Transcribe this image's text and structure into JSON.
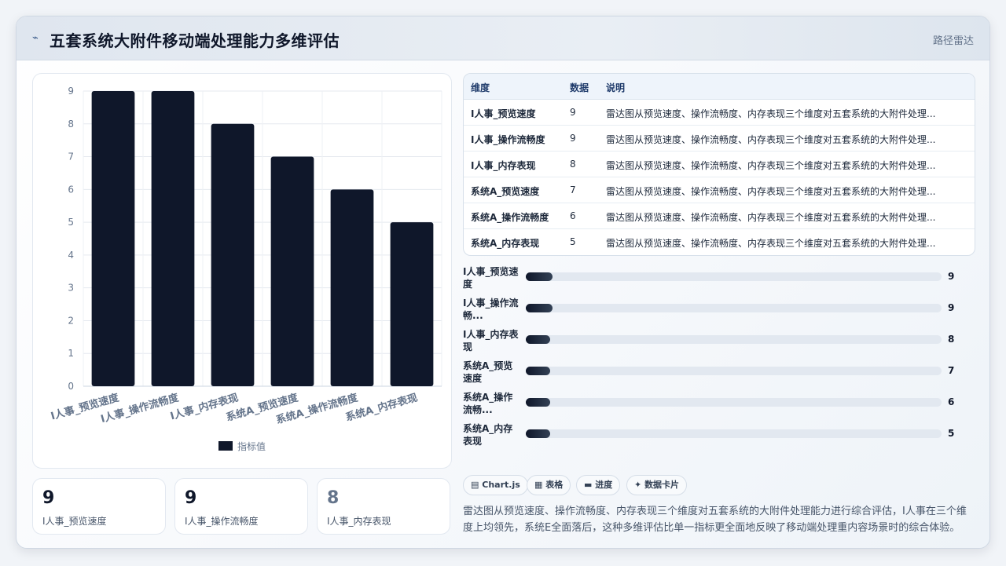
{
  "header": {
    "title": "五套系统大附件移动端处理能力多维评估",
    "icon": "trend-icon",
    "tag": "路径雷达"
  },
  "chart_data": {
    "type": "bar",
    "categories": [
      "I人事_预览速度",
      "I人事_操作流畅度",
      "I人事_内存表现",
      "系统A_预览速度",
      "系统A_操作流畅度",
      "系统A_内存表现"
    ],
    "series": [
      {
        "name": "指标值",
        "values": [
          9,
          9,
          8,
          7,
          6,
          5
        ]
      }
    ],
    "ylim": [
      0,
      9
    ],
    "yticks": [
      0,
      1,
      2,
      3,
      4,
      5,
      6,
      7,
      8,
      9
    ],
    "grid": true,
    "legend": "bottom",
    "bar_color": "#0f172a"
  },
  "table": {
    "columns": [
      "维度",
      "数据",
      "说明"
    ],
    "rows": [
      {
        "name": "I人事_预览速度",
        "value": "9",
        "note": "雷达图从预览速度、操作流畅度、内存表现三个维度对五套系统的大附件处理..."
      },
      {
        "name": "I人事_操作流畅度",
        "value": "9",
        "note": "雷达图从预览速度、操作流畅度、内存表现三个维度对五套系统的大附件处理..."
      },
      {
        "name": "I人事_内存表现",
        "value": "8",
        "note": "雷达图从预览速度、操作流畅度、内存表现三个维度对五套系统的大附件处理..."
      },
      {
        "name": "系统A_预览速度",
        "value": "7",
        "note": "雷达图从预览速度、操作流畅度、内存表现三个维度对五套系统的大附件处理..."
      },
      {
        "name": "系统A_操作流畅度",
        "value": "6",
        "note": "雷达图从预览速度、操作流畅度、内存表现三个维度对五套系统的大附件处理..."
      },
      {
        "name": "系统A_内存表现",
        "value": "5",
        "note": "雷达图从预览速度、操作流畅度、内存表现三个维度对五套系统的大附件处理..."
      }
    ]
  },
  "progress": {
    "max": 9,
    "items": [
      {
        "label": "I人事_预览速度",
        "value": 9,
        "fill": 0.065
      },
      {
        "label": "I人事_操作流畅...",
        "value": 9,
        "fill": 0.065
      },
      {
        "label": "I人事_内存表现",
        "value": 8,
        "fill": 0.058
      },
      {
        "label": "系统A_预览速度",
        "value": 7,
        "fill": 0.058
      },
      {
        "label": "系统A_操作流畅...",
        "value": 6,
        "fill": 0.058
      },
      {
        "label": "系统A_内存表现",
        "value": 5,
        "fill": 0.058
      }
    ]
  },
  "stats": [
    {
      "value": "9",
      "label": "I人事_预览速度"
    },
    {
      "value": "9",
      "label": "I人事_操作流畅度"
    },
    {
      "value": "8",
      "label": "I人事_内存表现"
    }
  ],
  "chips": [
    {
      "icon": "chart-icon",
      "label": "Chart.js"
    },
    {
      "icon": "table-icon",
      "label": "表格"
    },
    {
      "icon": "progress-icon",
      "label": "进度"
    },
    {
      "icon": "card-icon",
      "label": "数据卡片"
    }
  ],
  "description": "雷达图从预览速度、操作流畅度、内存表现三个维度对五套系统的大附件处理能力进行综合评估，I人事在三个维度上均领先，系统E全面落后，这种多维评估比单一指标更全面地反映了移动端处理重内容场景时的综合体验。"
}
